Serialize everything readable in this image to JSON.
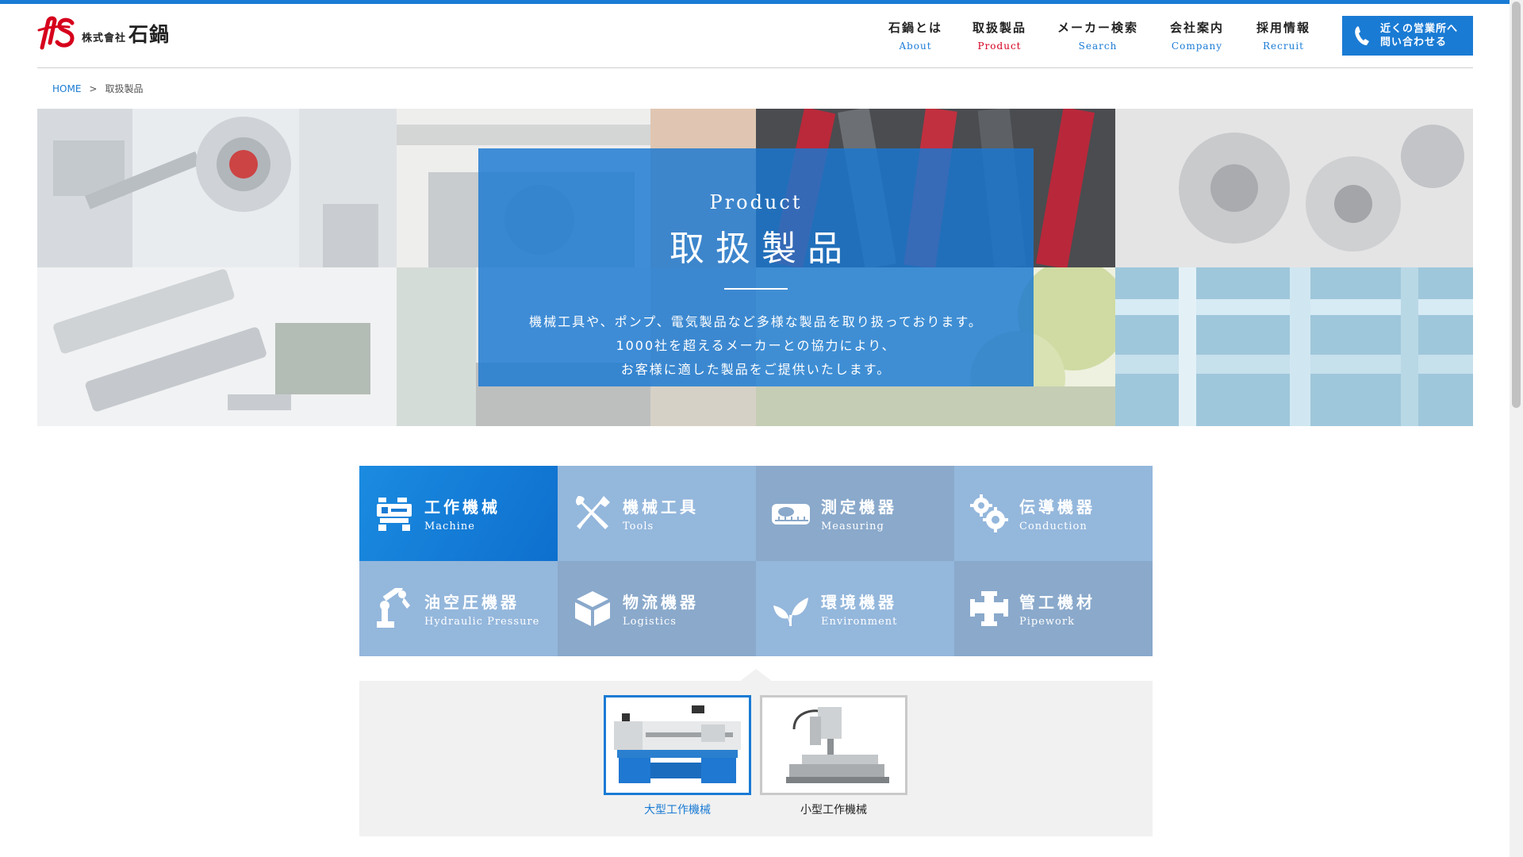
{
  "header": {
    "logo": {
      "small_text": "株式會社",
      "big_text": "石鍋"
    },
    "nav": [
      {
        "jp": "石鍋とは",
        "en": "About"
      },
      {
        "jp": "取扱製品",
        "en": "Product"
      },
      {
        "jp": "メーカー検索",
        "en": "Search"
      },
      {
        "jp": "会社案内",
        "en": "Company"
      },
      {
        "jp": "採用情報",
        "en": "Recruit"
      }
    ],
    "contact": {
      "line1": "近くの営業所へ",
      "line2": "問い合わせる"
    }
  },
  "breadcrumb": {
    "home": "HOME",
    "separator": ">",
    "current": "取扱製品"
  },
  "hero": {
    "en": "Product",
    "title": "取扱製品",
    "description": [
      "機械工具や、ポンプ、電気製品など多様な製品を取り扱っております。",
      "1000社を超えるメーカーとの協力により、",
      "お客様に適した製品をご提供いたします。"
    ]
  },
  "categories": [
    {
      "jp": "工作機械",
      "en": "Machine",
      "icon": "lathe-icon"
    },
    {
      "jp": "機械工具",
      "en": "Tools",
      "icon": "tools-icon"
    },
    {
      "jp": "測定機器",
      "en": "Measuring",
      "icon": "tape-measure-icon"
    },
    {
      "jp": "伝導機器",
      "en": "Conduction",
      "icon": "gears-icon"
    },
    {
      "jp": "油空圧機器",
      "en": "Hydraulic Pressure",
      "icon": "robot-arm-icon"
    },
    {
      "jp": "物流機器",
      "en": "Logistics",
      "icon": "box-icon"
    },
    {
      "jp": "環境機器",
      "en": "Environment",
      "icon": "leaf-icon"
    },
    {
      "jp": "管工機材",
      "en": "Pipework",
      "icon": "pipe-icon"
    }
  ],
  "subcategories": [
    {
      "label": "大型工作機械"
    },
    {
      "label": "小型工作機械"
    }
  ],
  "colors": {
    "accent": "#1a7bd4",
    "active_nav_en": "#d4001f",
    "active_category": "#1b8be0",
    "category_light": "#94b7dc",
    "category_dark": "#8aa9cb",
    "panel": "#f1f1f1"
  }
}
